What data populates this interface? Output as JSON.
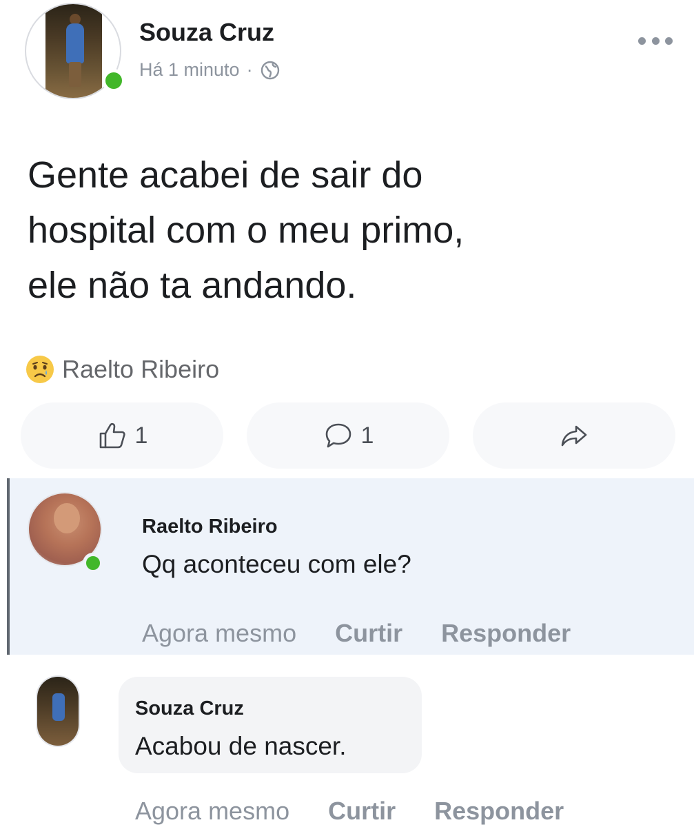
{
  "post": {
    "author": "Souza Cruz",
    "time": "Há 1 minuto",
    "separator": "·",
    "privacy_icon": "globe-icon",
    "text_lines": [
      "Gente acabei de sair do",
      "hospital com o meu primo,",
      "ele não ta andando."
    ],
    "reaction_icon": "sad-emoji-icon",
    "reaction_by": "Raelto Ribeiro",
    "likes": "1",
    "comments": "1"
  },
  "comments": [
    {
      "name": "Raelto Ribeiro",
      "text": "Qq aconteceu com ele?",
      "time": "Agora mesmo",
      "like": "Curtir",
      "reply": "Responder"
    },
    {
      "name": "Souza Cruz",
      "text": "Acabou de nascer.",
      "time": "Agora mesmo",
      "like": "Curtir",
      "reply": "Responder"
    }
  ],
  "colors": {
    "online": "#42b72a",
    "muted_text": "#8d949e",
    "comment_highlight": "#eef3fa"
  }
}
